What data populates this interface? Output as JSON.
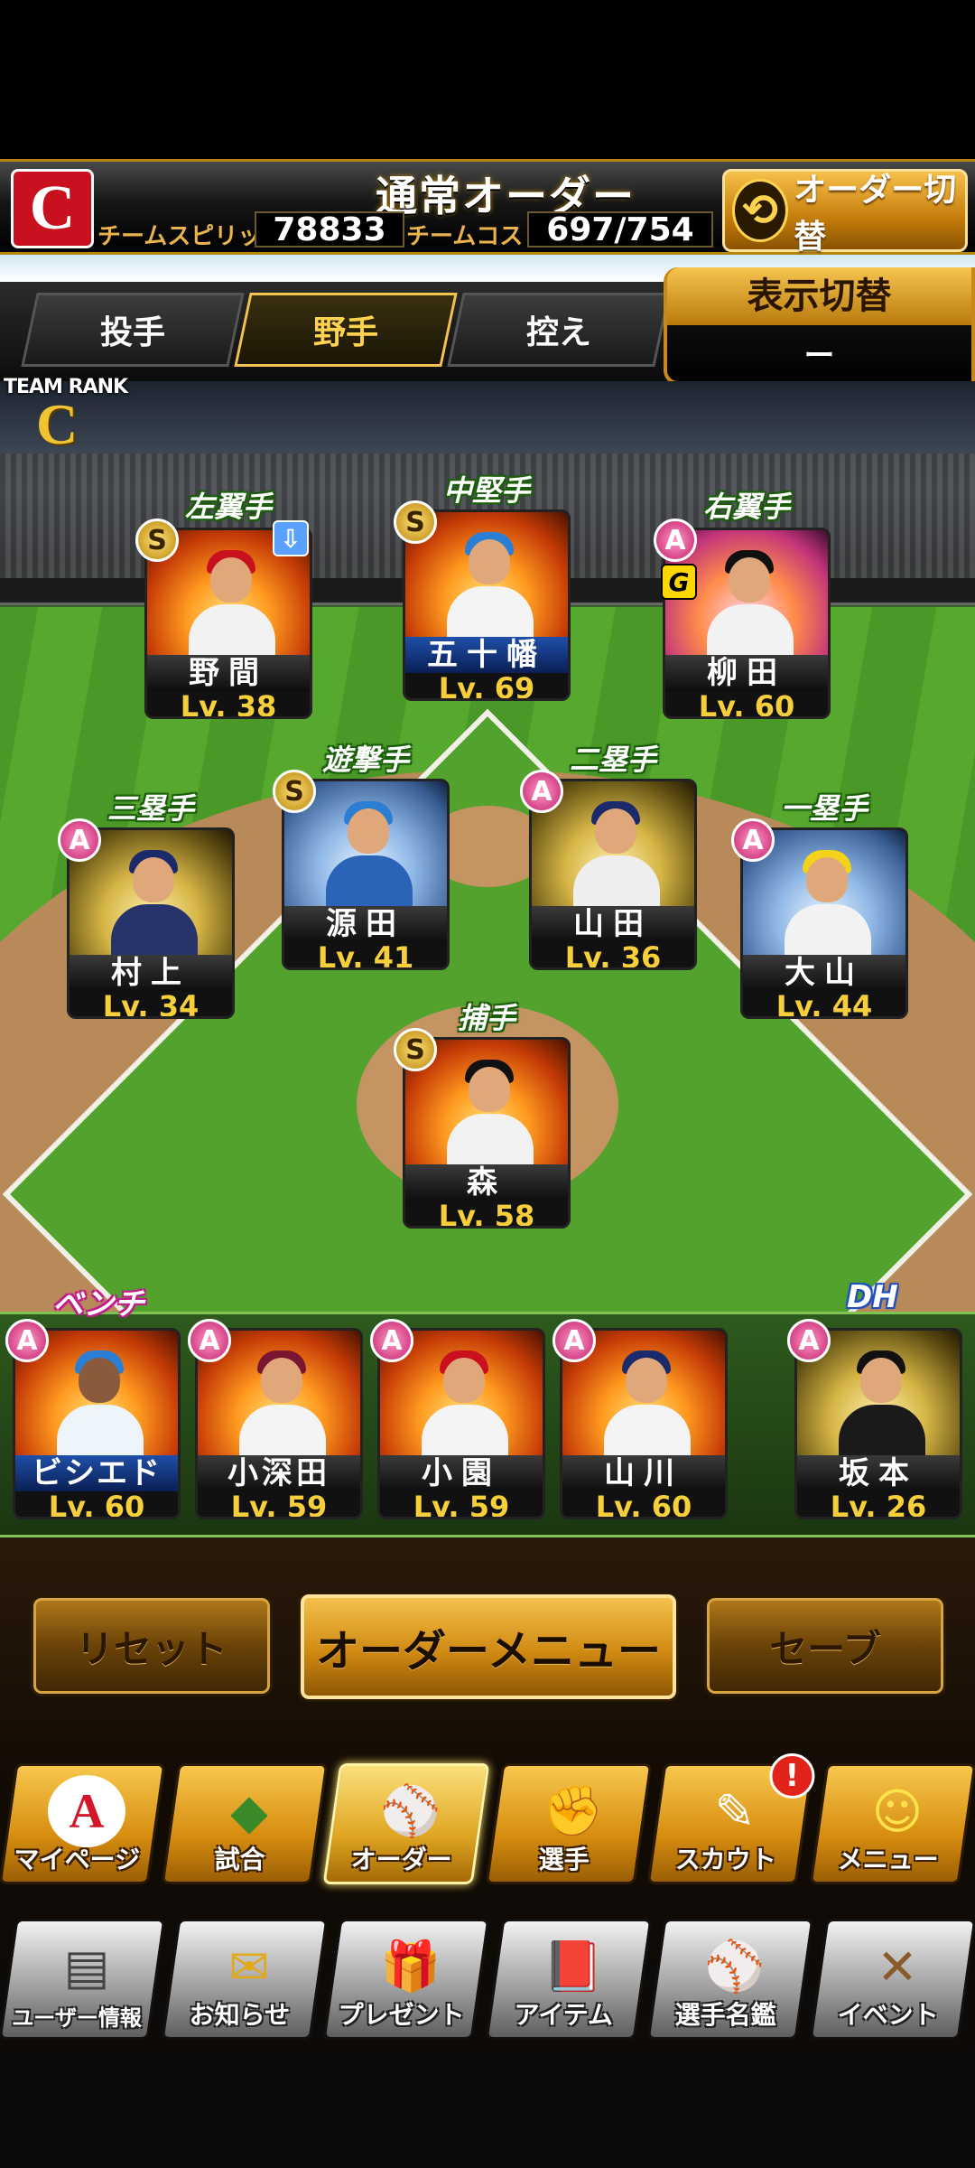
{
  "header": {
    "team_logo_letter": "C",
    "title": "通常オーダー",
    "team_spirits_label": "チームスピリッツ",
    "team_spirits_value": "78833",
    "team_cost_label": "チームコスト",
    "team_cost_value": "697/754",
    "switch_order_label": "オーダー切替",
    "switch_order_icon": "refresh-arrows-icon"
  },
  "tabs": [
    {
      "label": "投手",
      "active": false
    },
    {
      "label": "野手",
      "active": true
    },
    {
      "label": "控え",
      "active": false
    }
  ],
  "display_toggle": {
    "title": "表示切替",
    "value": "ー"
  },
  "team_rank": {
    "label": "TEAM RANK",
    "value": "C"
  },
  "field_players": {
    "lf": {
      "position": "左翼手",
      "name": "野間",
      "level": "Lv. 38",
      "rarity": "S"
    },
    "cf": {
      "position": "中堅手",
      "name": "五十幡",
      "level": "Lv. 69",
      "rarity": "S"
    },
    "rf": {
      "position": "右翼手",
      "name": "柳田",
      "level": "Lv. 60",
      "rarity": "A",
      "badge": "G"
    },
    "ss": {
      "position": "遊撃手",
      "name": "源田",
      "level": "Lv. 41",
      "rarity": "S"
    },
    "b2": {
      "position": "二塁手",
      "name": "山田",
      "level": "Lv. 36",
      "rarity": "A"
    },
    "b3": {
      "position": "三塁手",
      "name": "村上",
      "level": "Lv. 34",
      "rarity": "A"
    },
    "b1": {
      "position": "一塁手",
      "name": "大山",
      "level": "Lv. 44",
      "rarity": "A"
    },
    "c": {
      "position": "捕手",
      "name": "森",
      "level": "Lv. 58",
      "rarity": "S"
    }
  },
  "bench": {
    "title": "ベンチ",
    "players": [
      {
        "name": "ビシエド",
        "level": "Lv. 60",
        "rarity": "A"
      },
      {
        "name": "小深田",
        "level": "Lv. 59",
        "rarity": "A"
      },
      {
        "name": "小園",
        "level": "Lv. 59",
        "rarity": "A"
      },
      {
        "name": "山川",
        "level": "Lv. 60",
        "rarity": "A"
      }
    ]
  },
  "dh": {
    "title": "DH",
    "name": "坂本",
    "level": "Lv. 26",
    "rarity": "A"
  },
  "actions": {
    "reset": "リセット",
    "order_menu": "オーダーメニュー",
    "save": "セーブ"
  },
  "nav_main": [
    {
      "label": "マイページ",
      "icon": "a-logo-icon",
      "glyph": "A"
    },
    {
      "label": "試合",
      "icon": "stadium-icon",
      "glyph": "◆"
    },
    {
      "label": "オーダー",
      "icon": "field-formation-icon",
      "glyph": "⚾"
    },
    {
      "label": "選手",
      "icon": "player-icon",
      "glyph": "✊"
    },
    {
      "label": "スカウト",
      "icon": "scout-icon",
      "glyph": "✎",
      "notify": "!"
    },
    {
      "label": "メニュー",
      "icon": "menu-character-icon",
      "glyph": "☺"
    }
  ],
  "nav_sub": [
    {
      "label": "ユーザー情報",
      "icon": "user-card-icon",
      "glyph": "▤"
    },
    {
      "label": "お知らせ",
      "icon": "notice-icon",
      "glyph": "✉"
    },
    {
      "label": "プレゼント",
      "icon": "gift-icon",
      "glyph": "🎁"
    },
    {
      "label": "アイテム",
      "icon": "item-book-icon",
      "glyph": "📕"
    },
    {
      "label": "選手名鑑",
      "icon": "player-directory-icon",
      "glyph": "⚾"
    },
    {
      "label": "イベント",
      "icon": "event-bats-icon",
      "glyph": "✕"
    }
  ]
}
